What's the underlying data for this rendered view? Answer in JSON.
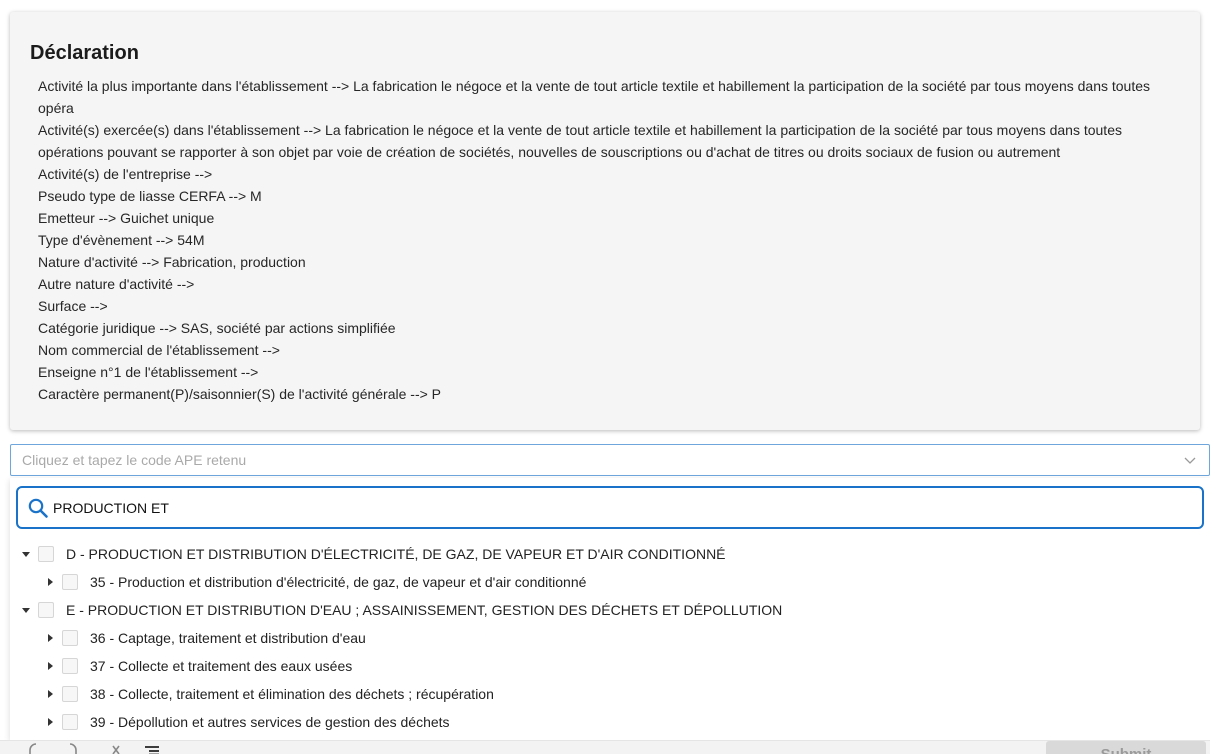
{
  "declaration": {
    "title": "Déclaration",
    "lines": [
      "Activité la plus importante dans l'établissement --> La fabrication le négoce et la vente de tout article textile et habillement la participation de la société par tous moyens dans toutes opéra",
      "Activité(s) exercée(s) dans l'établissement --> La fabrication le négoce et la vente de tout article textile et habillement la participation de la société par tous moyens dans toutes opérations pouvant se rapporter à son objet par voie de création de sociétés, nouvelles de souscriptions ou d'achat de titres ou droits sociaux de fusion ou autrement",
      "Activité(s) de l'entreprise -->",
      "Pseudo type de liasse CERFA --> M",
      "Emetteur --> Guichet unique",
      "Type d'évènement --> 54M",
      "Nature d'activité --> Fabrication, production",
      "Autre nature d'activité -->",
      "Surface -->",
      "Catégorie juridique --> SAS, société par actions simplifiée",
      "Nom commercial de l'établissement -->",
      "Enseigne n°1 de l'établissement -->",
      "Caractère permanent(P)/saisonnier(S) de l'activité générale --> P"
    ]
  },
  "ape_select": {
    "placeholder": "Cliquez et tapez le code APE retenu",
    "chevron_icon": "chevron-down-icon"
  },
  "search": {
    "icon": "search-icon",
    "value": "PRODUCTION ET"
  },
  "tree": [
    {
      "level": 0,
      "label": "D - PRODUCTION ET DISTRIBUTION D'ÉLECTRICITÉ, DE GAZ, DE VAPEUR ET D'AIR CONDITIONNÉ",
      "expanded": true,
      "checked": false
    },
    {
      "level": 1,
      "label": "35 - Production et distribution d'électricité, de gaz, de vapeur et d'air conditionné",
      "expanded": false,
      "checked": false
    },
    {
      "level": 0,
      "label": "E - PRODUCTION ET DISTRIBUTION D'EAU ; ASSAINISSEMENT, GESTION DES DÉCHETS ET DÉPOLLUTION",
      "expanded": true,
      "checked": false
    },
    {
      "level": 1,
      "label": "36 - Captage, traitement et distribution d'eau",
      "expanded": false,
      "checked": false
    },
    {
      "level": 1,
      "label": "37 - Collecte et traitement des eaux usées",
      "expanded": false,
      "checked": false
    },
    {
      "level": 1,
      "label": "38 - Collecte, traitement et élimination des déchets ; récupération",
      "expanded": false,
      "checked": false
    },
    {
      "level": 1,
      "label": "39 - Dépollution et autres services de gestion des déchets",
      "expanded": false,
      "checked": false
    }
  ],
  "footer": {
    "tools": [
      "undo-icon",
      "redo-icon",
      "close-icon",
      "list-icon"
    ],
    "submit_label": "Submit"
  },
  "colors": {
    "accent": "#1a73c8",
    "select_border": "#6fa7dc",
    "card_background": "#f5f5f5"
  }
}
